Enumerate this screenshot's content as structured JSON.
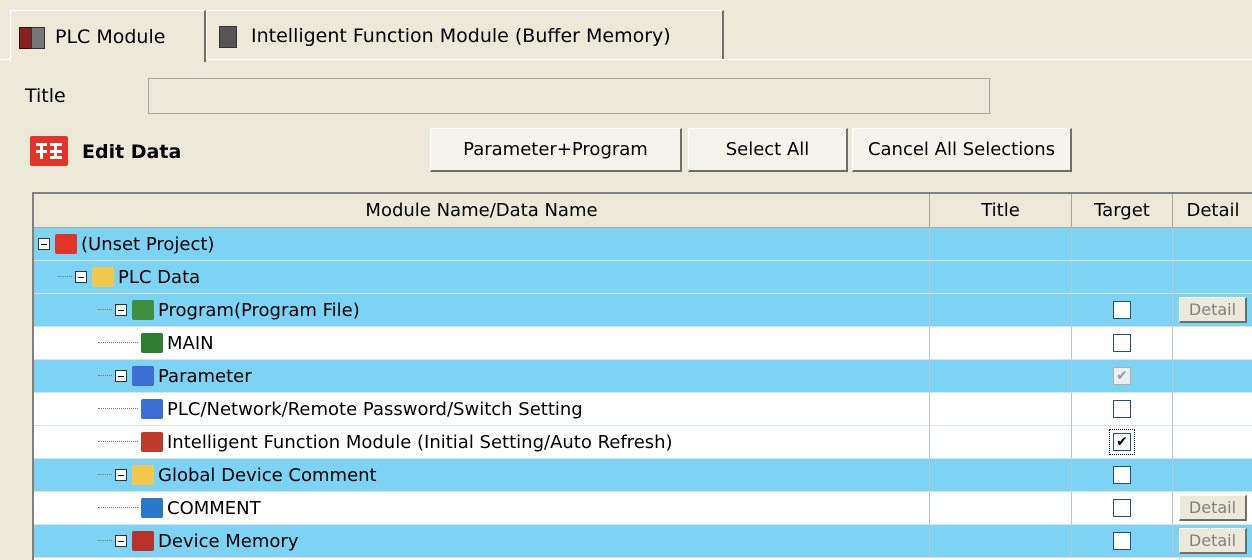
{
  "tabs": [
    {
      "label": "PLC Module",
      "active": true
    },
    {
      "label": "Intelligent Function Module (Buffer Memory)",
      "active": false
    }
  ],
  "title_field": {
    "label": "Title",
    "value": ""
  },
  "edit_data": {
    "label": "Edit Data",
    "icon_text": "ᄇ"
  },
  "buttons": {
    "param_program": "Parameter+Program",
    "select_all": "Select All",
    "cancel_all": "Cancel All Selections"
  },
  "table": {
    "columns": [
      "Module Name/Data Name",
      "Title",
      "Target",
      "Detail"
    ],
    "rows": [
      {
        "name": "(Unset Project)",
        "level": 0,
        "expander": true,
        "style": "blue",
        "icon": "project-icon",
        "icon_color": "#e3342a",
        "target": null,
        "detail": null
      },
      {
        "name": "PLC Data",
        "level": 1,
        "expander": true,
        "style": "blue",
        "icon": "folder-icon",
        "icon_color": "#f2c84b",
        "target": null,
        "detail": null
      },
      {
        "name": "Program(Program File)",
        "level": 2,
        "expander": true,
        "style": "blue",
        "icon": "program-icon",
        "icon_color": "#3f8f3f",
        "target": false,
        "detail": "Detail"
      },
      {
        "name": "MAIN",
        "level": 3,
        "expander": false,
        "style": "white",
        "icon": "program-file-icon",
        "icon_color": "#2e7d32",
        "target": false,
        "detail": null
      },
      {
        "name": "Parameter",
        "level": 2,
        "expander": true,
        "style": "blue",
        "icon": "parameter-icon",
        "icon_color": "#3b6fd6",
        "target": "disabled-checked",
        "detail": null
      },
      {
        "name": "PLC/Network/Remote Password/Switch Setting",
        "level": 3,
        "expander": false,
        "style": "white",
        "icon": "network-icon",
        "icon_color": "#3b6fd6",
        "target": false,
        "detail": null
      },
      {
        "name": "Intelligent Function Module (Initial Setting/Auto Refresh)",
        "level": 3,
        "expander": false,
        "style": "white",
        "icon": "module-icon",
        "icon_color": "#c0392b",
        "target": true,
        "focused": true,
        "detail": null
      },
      {
        "name": "Global Device Comment",
        "level": 2,
        "expander": true,
        "style": "blue",
        "icon": "folder-icon",
        "icon_color": "#f2c84b",
        "target": false,
        "detail": null
      },
      {
        "name": "COMMENT",
        "level": 3,
        "expander": false,
        "style": "white",
        "icon": "comment-icon",
        "icon_color": "#2a78c9",
        "target": false,
        "detail": "Detail"
      },
      {
        "name": "Device Memory",
        "level": 2,
        "expander": true,
        "style": "blue",
        "icon": "device-memory-icon",
        "icon_color": "#b83227",
        "target": false,
        "detail": "Detail"
      }
    ]
  }
}
